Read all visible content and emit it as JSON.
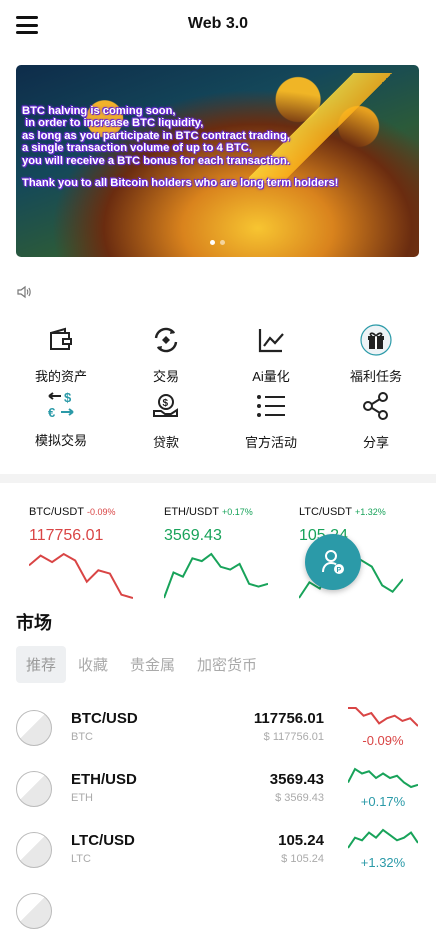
{
  "header": {
    "title": "Web 3.0"
  },
  "banner": {
    "lines": [
      "BTC halving is coming soon,",
      " in order to increase BTC liquidity,",
      "as long as you participate in BTC contract trading,",
      "a single transaction volume of up to 4 BTC,",
      "you will receive a BTC bonus for each transaction."
    ],
    "thanks": "Thank you to all Bitcoin holders who are long term holders!"
  },
  "menu": [
    {
      "label": "我的资产",
      "icon": "wallet-icon"
    },
    {
      "label": "交易",
      "icon": "exchange-icon"
    },
    {
      "label": "Ai量化",
      "icon": "line-chart-icon"
    },
    {
      "label": "福利任务",
      "icon": "gift-icon"
    },
    {
      "label": "模拟交易",
      "icon": "currency-swap-icon"
    },
    {
      "label": "贷款",
      "icon": "loan-icon"
    },
    {
      "label": "官方活动",
      "icon": "list-icon"
    },
    {
      "label": "分享",
      "icon": "share-icon"
    }
  ],
  "tickers": [
    {
      "symbol": "BTC/USDT",
      "change": "-0.09%",
      "price": "117756.01",
      "trend": "down",
      "spark": [
        20,
        14,
        18,
        13,
        17,
        30,
        23,
        25,
        38,
        40
      ]
    },
    {
      "symbol": "ETH/USDT",
      "change": "+0.17%",
      "price": "3569.43",
      "trend": "up",
      "spark": [
        40,
        22,
        25,
        12,
        14,
        9,
        18,
        20,
        16,
        30,
        32,
        30
      ]
    },
    {
      "symbol": "LTC/USDT",
      "change": "+1.32%",
      "price": "105.24",
      "trend": "up",
      "spark": [
        40,
        30,
        34,
        20,
        26,
        12,
        16,
        20,
        32,
        36,
        28
      ]
    }
  ],
  "market": {
    "title": "市场",
    "tabs": [
      "推荐",
      "收藏",
      "贵金属",
      "加密货币"
    ],
    "rows": [
      {
        "pair": "BTC/USD",
        "base": "BTC",
        "price": "117756.01",
        "usd": "$ 117756.01",
        "change": "-0.09%",
        "trend": "down",
        "spark": [
          6,
          6,
          9,
          8,
          12,
          10,
          9,
          11,
          10,
          13
        ]
      },
      {
        "pair": "ETH/USD",
        "base": "ETH",
        "price": "3569.43",
        "usd": "$ 3569.43",
        "change": "+0.17%",
        "trend": "up",
        "spark": [
          12,
          6,
          8,
          7,
          10,
          8,
          10,
          9,
          12,
          14,
          13
        ]
      },
      {
        "pair": "LTC/USD",
        "base": "LTC",
        "price": "105.24",
        "usd": "$ 105.24",
        "change": "+1.32%",
        "trend": "up",
        "spark": [
          12,
          8,
          9,
          6,
          8,
          5,
          7,
          9,
          8,
          6,
          10
        ]
      }
    ]
  },
  "colors": {
    "down": "#d94545",
    "up": "#18a35a",
    "pct_up": "#2b9aa8",
    "accent": "#2b9aa8"
  }
}
